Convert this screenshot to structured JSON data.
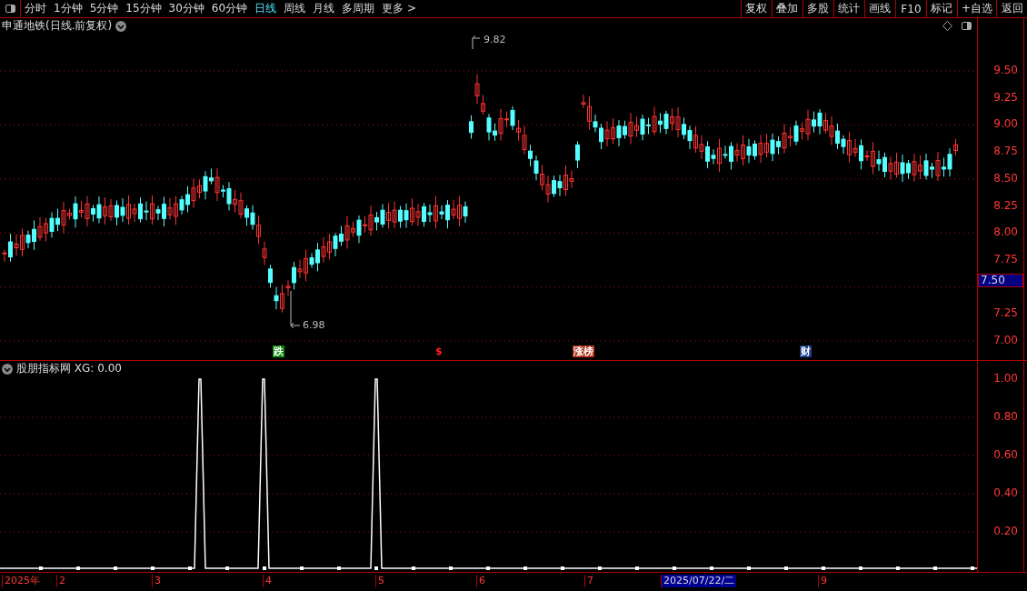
{
  "toolbar": {
    "periods": [
      {
        "label": "分时",
        "selected": false
      },
      {
        "label": "1分钟",
        "selected": false
      },
      {
        "label": "5分钟",
        "selected": false
      },
      {
        "label": "15分钟",
        "selected": false
      },
      {
        "label": "30分钟",
        "selected": false
      },
      {
        "label": "60分钟",
        "selected": false
      },
      {
        "label": "日线",
        "selected": true
      },
      {
        "label": "周线",
        "selected": false
      },
      {
        "label": "月线",
        "selected": false
      },
      {
        "label": "多周期",
        "selected": false
      },
      {
        "label": "更多 >",
        "selected": false
      }
    ],
    "actions": [
      "复权",
      "叠加",
      "多股",
      "统计",
      "画线",
      "F10",
      "标记",
      "+自选",
      "返回"
    ]
  },
  "price_chart": {
    "title": "申通地铁(日线.前复权)",
    "high_label": "9.82",
    "low_label": "6.98",
    "current_price": "7.50",
    "y_ticks": [
      "9.50",
      "9.25",
      "9.00",
      "8.75",
      "8.50",
      "8.25",
      "8.00",
      "7.75",
      "7.25",
      "7.00"
    ],
    "event_marks": [
      {
        "label": "跌",
        "kind": "fall"
      },
      {
        "label": "$",
        "kind": "money"
      },
      {
        "label": "涨榜",
        "kind": "rank"
      },
      {
        "label": "财",
        "kind": "finance"
      }
    ]
  },
  "indicator": {
    "title": "股朋指标网 XG: 0.00",
    "y_ticks": [
      "1.00",
      "0.80",
      "0.60",
      "0.40",
      "0.20"
    ]
  },
  "date_axis": [
    {
      "label": "2025年",
      "selected": false
    },
    {
      "label": "2",
      "selected": false
    },
    {
      "label": "3",
      "selected": false
    },
    {
      "label": "4",
      "selected": false
    },
    {
      "label": "5",
      "selected": false
    },
    {
      "label": "6",
      "selected": false
    },
    {
      "label": "7",
      "selected": false
    },
    {
      "label": "2025/07/22/二",
      "selected": true
    },
    {
      "label": "9",
      "selected": false
    }
  ]
}
